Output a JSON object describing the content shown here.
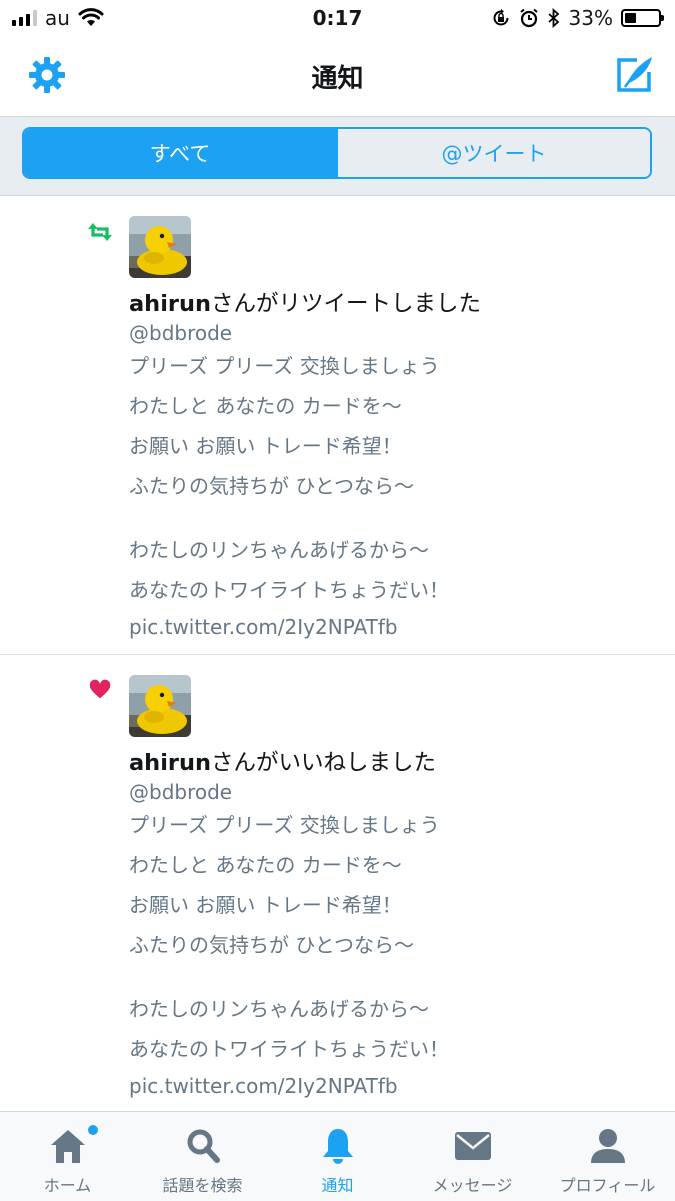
{
  "status_bar": {
    "carrier": "au",
    "time": "0:17",
    "battery_percent": "33%",
    "battery_level": 0.33
  },
  "nav": {
    "title": "通知"
  },
  "segments": {
    "all": "すべて",
    "mentions": "@ツイート"
  },
  "notifications": [
    {
      "type": "retweet",
      "user": "ahirun",
      "action": "さんがリツイートしました",
      "handle": "@bdbrode",
      "lines": [
        "プリーズ プリーズ 交換しましょう",
        "わたしと あなたの カードを〜",
        "お願い お願い トレード希望！",
        "ふたりの気持ちが ひとつなら〜"
      ],
      "lines2": [
        "わたしのリンちゃんあげるから〜",
        "あなたのトワイライトちょうだい！"
      ],
      "link": "pic.twitter.com/2Iy2NPATfb"
    },
    {
      "type": "like",
      "user": "ahirun",
      "action": "さんがいいねしました",
      "handle": "@bdbrode",
      "lines": [
        "プリーズ プリーズ 交換しましょう",
        "わたしと あなたの カードを〜",
        "お願い お願い トレード希望！",
        "ふたりの気持ちが ひとつなら〜"
      ],
      "lines2": [
        "わたしのリンちゃんあげるから〜",
        "あなたのトワイライトちょうだい！"
      ],
      "link": "pic.twitter.com/2Iy2NPATfb"
    }
  ],
  "tabs": [
    {
      "label": "ホーム",
      "icon": "home-icon"
    },
    {
      "label": "話題を検索",
      "icon": "search-icon"
    },
    {
      "label": "通知",
      "icon": "bell-icon"
    },
    {
      "label": "メッセージ",
      "icon": "envelope-icon"
    },
    {
      "label": "プロフィール",
      "icon": "person-icon"
    }
  ],
  "colors": {
    "accent": "#1da1f2",
    "retweet": "#17bf63",
    "like": "#e0245e",
    "secondary_text": "#657786"
  }
}
